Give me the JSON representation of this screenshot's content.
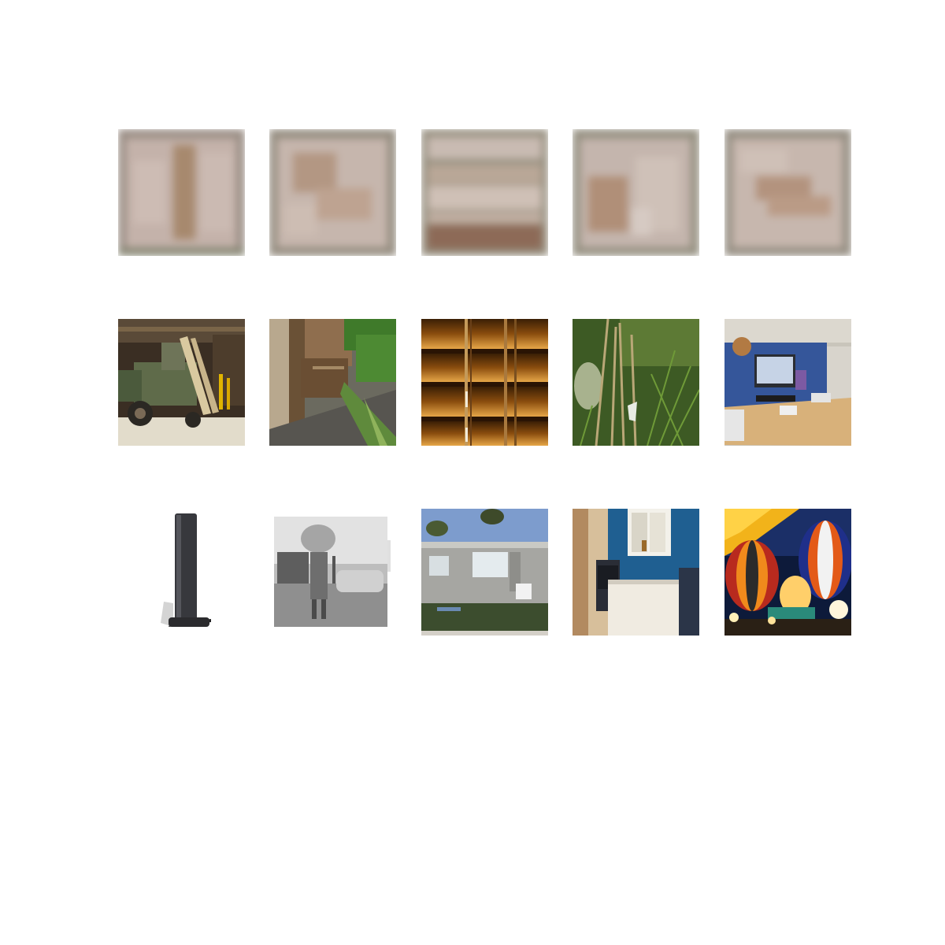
{
  "grid": {
    "rows": [
      {
        "row_name": "reconstruction-row",
        "tiles": [
          {
            "name": "blurry-reconstruction-1"
          },
          {
            "name": "blurry-reconstruction-2"
          },
          {
            "name": "blurry-reconstruction-3"
          },
          {
            "name": "blurry-reconstruction-4"
          },
          {
            "name": "blurry-reconstruction-5"
          }
        ]
      },
      {
        "row_name": "photo-row-1",
        "tiles": [
          {
            "name": "tractor-in-barn-photo"
          },
          {
            "name": "wooden-post-garden-photo"
          },
          {
            "name": "window-blinds-photo"
          },
          {
            "name": "grass-closeup-photo"
          },
          {
            "name": "office-desk-computer-photo"
          }
        ]
      },
      {
        "row_name": "photo-row-2",
        "tiles": [
          {
            "name": "tower-speaker-photo"
          },
          {
            "name": "bw-person-carrying-load-photo"
          },
          {
            "name": "mobile-home-photo"
          },
          {
            "name": "bathroom-interior-photo"
          },
          {
            "name": "hot-air-balloons-photo"
          }
        ]
      }
    ]
  }
}
